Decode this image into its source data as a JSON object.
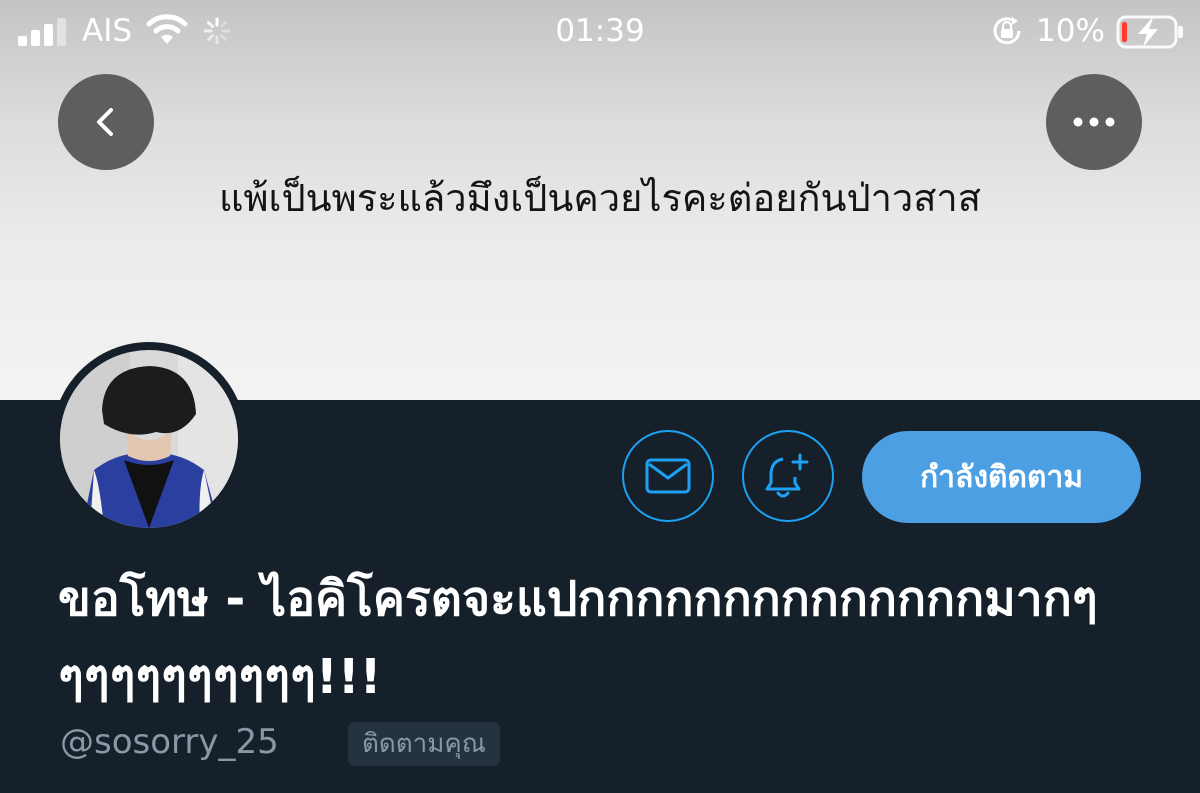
{
  "status_bar": {
    "carrier": "AIS",
    "time": "01:39",
    "battery_percent": "10%",
    "battery_level": 0.1,
    "battery_color": "#ff3b30",
    "icons": [
      "signal-icon",
      "wifi-icon",
      "loading-spinner-icon",
      "orientation-lock-icon",
      "battery-icon",
      "charging-bolt-icon"
    ]
  },
  "header": {
    "banner_text": "แพ้เป็นพระแล้วมึงเป็นควยไรคะต่อยกันป่าวสาส",
    "back_icon": "chevron-left-icon",
    "more_icon": "more-horizontal-icon"
  },
  "profile": {
    "display_name": "ขอโทษ - ไอคิโครตจะแปกกกกกกกกกกกกกกมากๆๆๆๆๆๆๆๆๆๆๆ!!!",
    "username": "@sosorry_25",
    "follows_you_badge": "ติดตามคุณ"
  },
  "actions": {
    "message_icon": "mail-icon",
    "notify_icon": "bell-plus-icon",
    "follow_label": "กำลังติดตาม"
  },
  "colors": {
    "background": "#15202b",
    "accent": "#1da1f2",
    "follow_button": "#4d9fe4",
    "secondary_text": "#8899a6"
  }
}
